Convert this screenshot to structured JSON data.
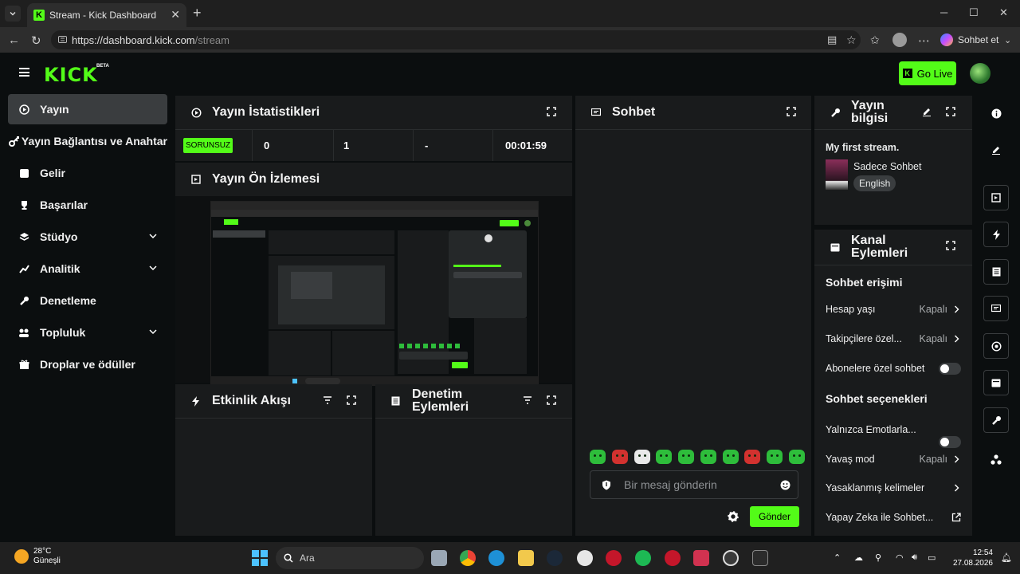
{
  "browser": {
    "tab_title": "Stream - Kick Dashboard",
    "tab_favicon": "K",
    "url_scheme_host": "https://dashboard.kick.com",
    "url_path": "/stream",
    "copilot_label": "Sohbet et"
  },
  "header": {
    "logo": "KICK",
    "beta": "BETA",
    "go_live": "Go Live"
  },
  "sidebar": {
    "items": [
      {
        "label": "Yayın",
        "icon": "play-circle-icon"
      },
      {
        "label": "Yayın Bağlantısı ve Anahtar",
        "icon": "link-icon"
      },
      {
        "label": "Gelir",
        "icon": "dollar-icon"
      },
      {
        "label": "Başarılar",
        "icon": "trophy-icon"
      },
      {
        "label": "Stüdyo",
        "icon": "studio-icon"
      },
      {
        "label": "Analitik",
        "icon": "chart-icon"
      },
      {
        "label": "Denetleme",
        "icon": "wrench-icon"
      },
      {
        "label": "Topluluk",
        "icon": "community-icon"
      },
      {
        "label": "Droplar ve ödüller",
        "icon": "gift-icon"
      }
    ]
  },
  "stats": {
    "title": "Yayın İstatistikleri",
    "badge": "SORUNSUZ",
    "viewers": "0",
    "followers": "1",
    "dash": "-",
    "duration": "00:01:59"
  },
  "preview": {
    "title": "Yayın Ön İzlemesi"
  },
  "activity": {
    "title": "Etkinlik Akışı"
  },
  "moderation": {
    "title_line1": "Denetim",
    "title_line2": "Eylemleri"
  },
  "chat": {
    "title": "Sohbet",
    "placeholder": "Bir mesaj gönderin",
    "send": "Gönder"
  },
  "stream_info": {
    "title_line1": "Yayın",
    "title_line2": "bilgisi",
    "stream_title": "My first stream.",
    "category": "Sadece Sohbet",
    "language": "English"
  },
  "channel_actions": {
    "title_line1": "Kanal",
    "title_line2": "Eylemleri",
    "chat_access": "Sohbet erişimi",
    "account_age": "Hesap yaşı",
    "account_age_value": "Kapalı",
    "followers_only": "Takipçilere özel...",
    "followers_only_value": "Kapalı",
    "subscribers_only": "Abonelere özel sohbet",
    "chat_options": "Sohbet seçenekleri",
    "emotes_only": "Yalnızca Emotlarla...",
    "slow_mode": "Yavaş mod",
    "slow_mode_value": "Kapalı",
    "banned_words": "Yasaklanmış kelimeler",
    "ai_chat": "Yapay Zeka ile Sohbet..."
  },
  "taskbar": {
    "temperature": "28°C",
    "weather": "Güneşli",
    "search": "Ara",
    "time": "12:54",
    "date": "27.08.2026"
  },
  "colors": {
    "accent": "#53fc18",
    "panel": "#191b1c",
    "background": "#0b0e0f"
  }
}
